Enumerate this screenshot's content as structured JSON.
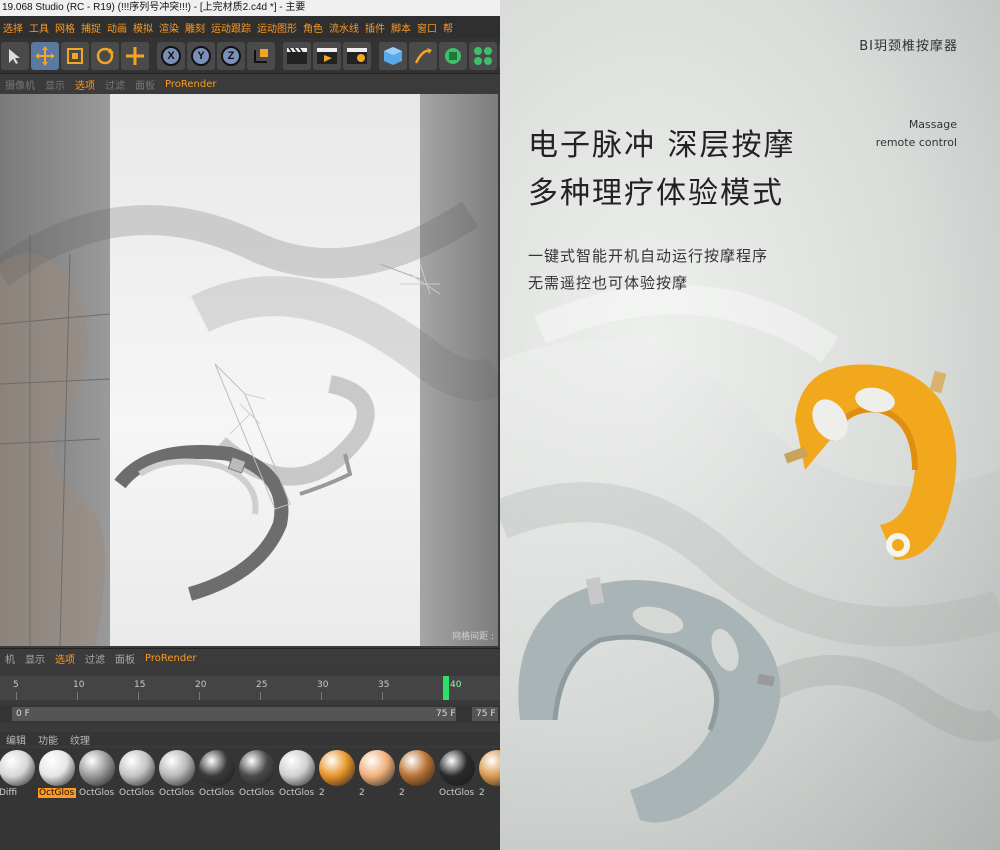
{
  "cinema4d": {
    "title": "19.068 Studio (RC - R19) (!!!序列号冲突!!!) - [上完材质2.c4d *] - 主要",
    "menu": [
      "选择",
      "工具",
      "网格",
      "捕捉",
      "动画",
      "模拟",
      "渲染",
      "雕刻",
      "运动跟踪",
      "运动图形",
      "角色",
      "流水线",
      "插件",
      "脚本",
      "窗口",
      "帮"
    ],
    "toolbar_icons": [
      "select-arrow-icon",
      "move-icon",
      "scale-icon",
      "rotate-icon",
      "move-cross-icon",
      "axis-x-icon",
      "axis-y-icon",
      "axis-z-icon",
      "coord-icon",
      "render-region-icon",
      "render-view-icon",
      "render-settings-icon",
      "cube-icon",
      "pen-icon",
      "nurbs-icon",
      "array-icon",
      "deformer-icon"
    ],
    "axis_labels": [
      "X",
      "Y",
      "Z"
    ],
    "viewport_menu": [
      "摄像机",
      "显示",
      "选项",
      "过滤",
      "面板",
      "ProRender"
    ],
    "grid_label": "网格间距 :",
    "timeline_menu": [
      "机",
      "显示",
      "选项",
      "过滤",
      "面板",
      "ProRender"
    ],
    "timeline_ticks": [
      "5",
      "10",
      "15",
      "20",
      "25",
      "30",
      "35",
      "40"
    ],
    "playhead_label": "40",
    "start_field": "0 F",
    "end_field": "75 F",
    "end_field2": "75 F",
    "material_menu": [
      "编辑",
      "功能",
      "纹理"
    ],
    "materials": [
      {
        "label": "Diffi",
        "color": "#d8d8d8",
        "selected": false
      },
      {
        "label": "OctGlos",
        "color": "#e6e6e6",
        "selected": true
      },
      {
        "label": "OctGlos",
        "color": "#9a9a9a",
        "selected": false
      },
      {
        "label": "OctGlos",
        "color": "#c4c4c4",
        "selected": false
      },
      {
        "label": "OctGlos",
        "color": "#b8b8b8",
        "selected": false
      },
      {
        "label": "OctGlos",
        "color": "#3a3a3a",
        "selected": false
      },
      {
        "label": "OctGlos",
        "color": "#4a4a4a",
        "selected": false
      },
      {
        "label": "OctGlos",
        "color": "#d0d0d0",
        "selected": false
      },
      {
        "label": "2",
        "color": "#e8952a",
        "selected": false
      },
      {
        "label": "2",
        "color": "#f0b07a",
        "selected": false
      },
      {
        "label": "2",
        "color": "#b87333",
        "selected": false
      },
      {
        "label": "OctGlos",
        "color": "#2a2a2a",
        "selected": false
      },
      {
        "label": "2",
        "color": "#d99a50",
        "selected": false
      }
    ]
  },
  "product": {
    "brand": "BI玥颈椎按摩器",
    "title1": "电子脉冲 深层按摩",
    "title2": "多种理疗体验模式",
    "eng1": "Massage",
    "eng2": "remote control",
    "desc1": "一键式智能开机自动运行按摩程序",
    "desc2": "无需遥控也可体验按摩",
    "colors": {
      "yellow": "#f2a81c",
      "gray_blue": "#a8b4b6"
    }
  }
}
